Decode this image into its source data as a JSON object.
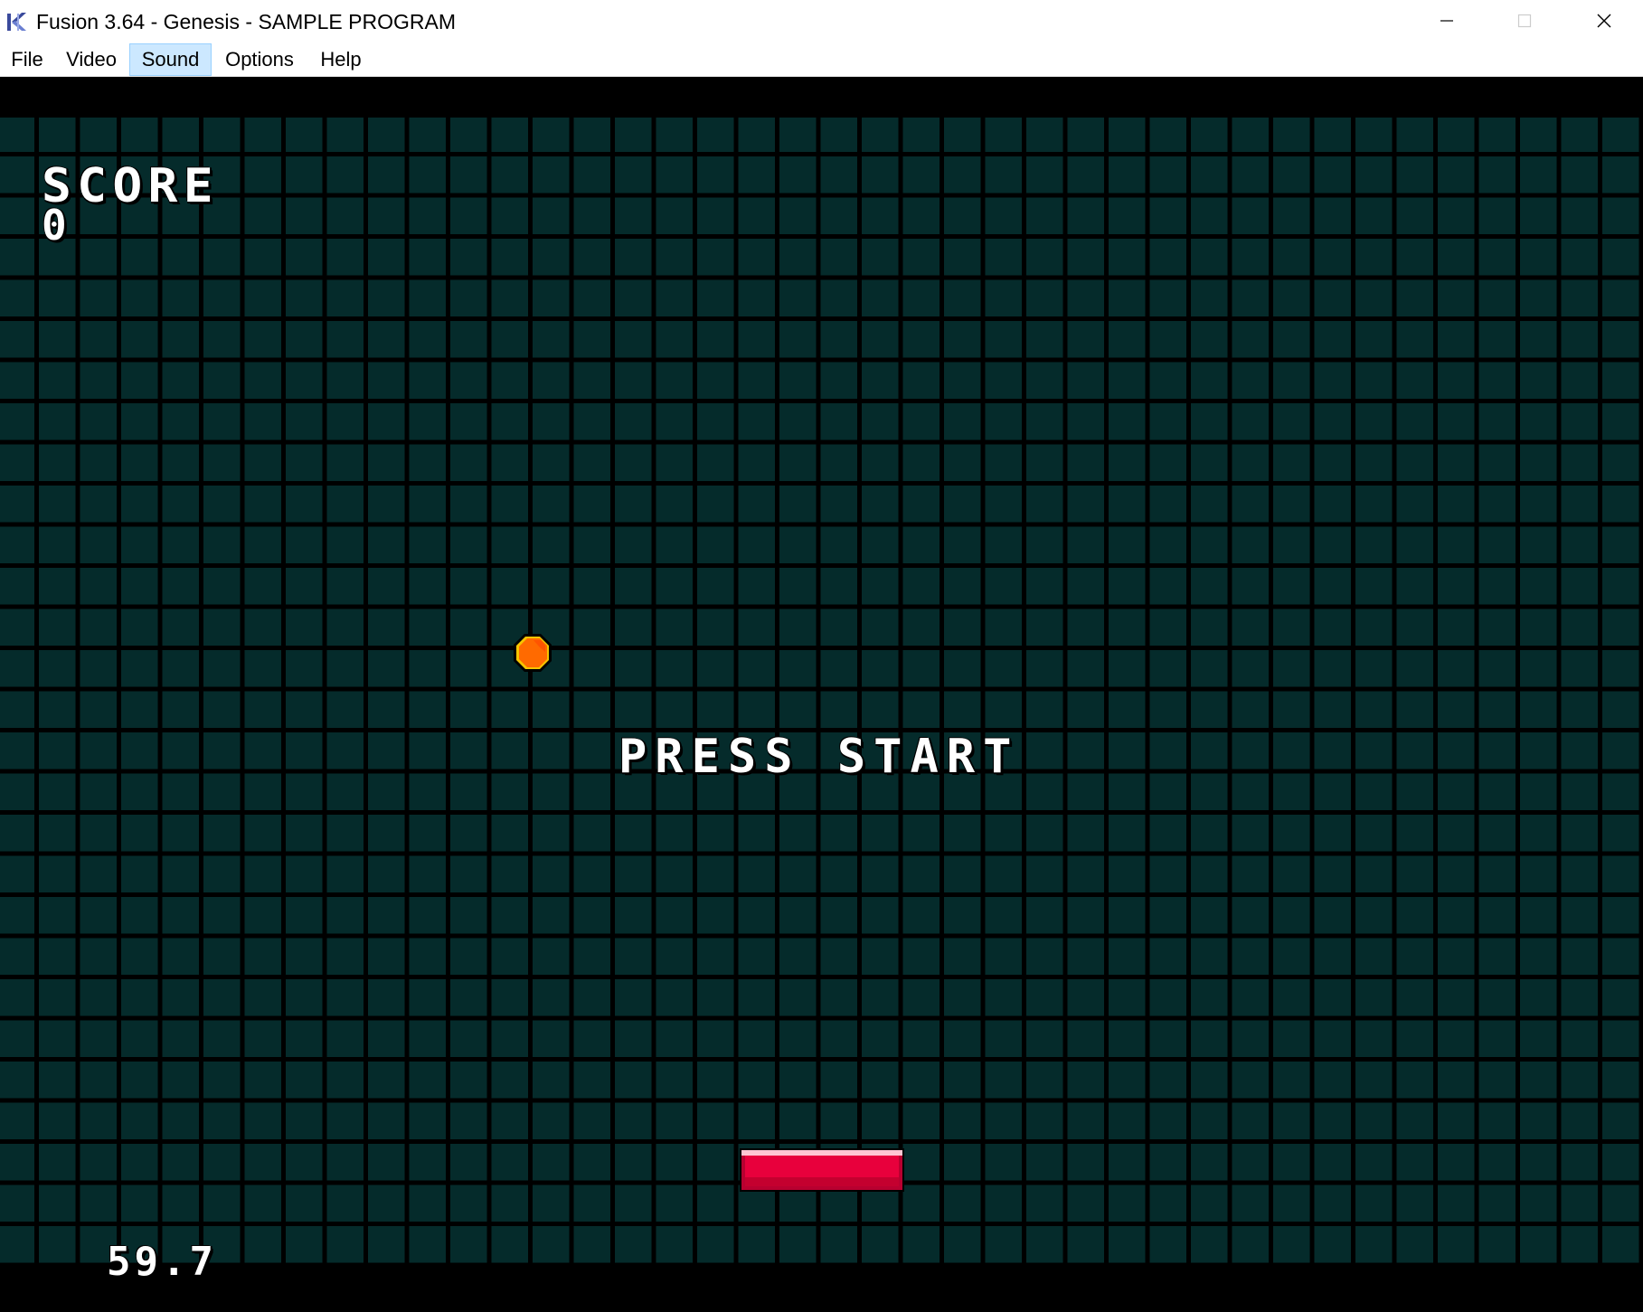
{
  "window": {
    "title": "Fusion 3.64 - Genesis - SAMPLE PROGRAM",
    "app_icon": "fusion-k-icon",
    "controls": {
      "minimize_icon": "minimize-icon",
      "maximize_icon": "maximize-icon",
      "close_icon": "close-icon"
    }
  },
  "menubar": {
    "items": [
      {
        "label": "File"
      },
      {
        "label": "Video"
      },
      {
        "label": "Sound",
        "highlighted": true
      },
      {
        "label": "Options"
      },
      {
        "label": "Help"
      }
    ]
  },
  "game": {
    "score_label": "SCORE",
    "score_value": "0",
    "prompt": "PRESS START",
    "fps": "59.7",
    "colors": {
      "background_tile": "#052b2b",
      "grid_line": "#000000",
      "ball": "#ff6a00",
      "paddle": "#e8003c",
      "text": "#ffffff"
    }
  }
}
